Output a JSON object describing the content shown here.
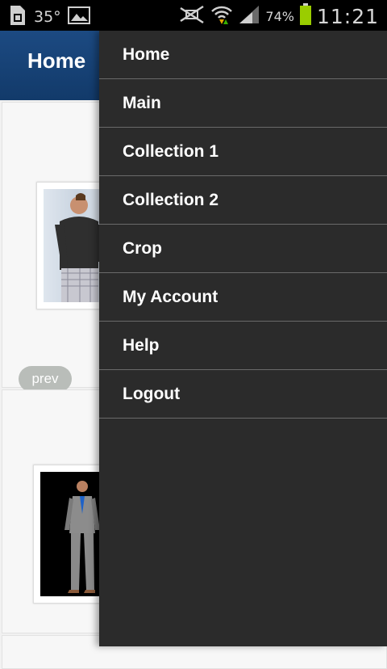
{
  "status_bar": {
    "temperature": "35°",
    "battery_percent": "74%",
    "time": "11:21",
    "icons": [
      "sim-card-icon",
      "image-icon",
      "silent-icon",
      "wifi-icon",
      "signal-icon",
      "battery-icon"
    ],
    "battery_level": 0.74,
    "battery_color": "#9acd00"
  },
  "app_bar": {
    "title": "Home",
    "color": "#1c4a82"
  },
  "carousel": {
    "prev_label": "prev"
  },
  "drawer": {
    "background": "#2b2b2b",
    "items": [
      {
        "label": "Home"
      },
      {
        "label": "Main"
      },
      {
        "label": "Collection 1"
      },
      {
        "label": "Collection 2"
      },
      {
        "label": "Crop"
      },
      {
        "label": "My Account"
      },
      {
        "label": "Help"
      },
      {
        "label": "Logout"
      }
    ]
  }
}
